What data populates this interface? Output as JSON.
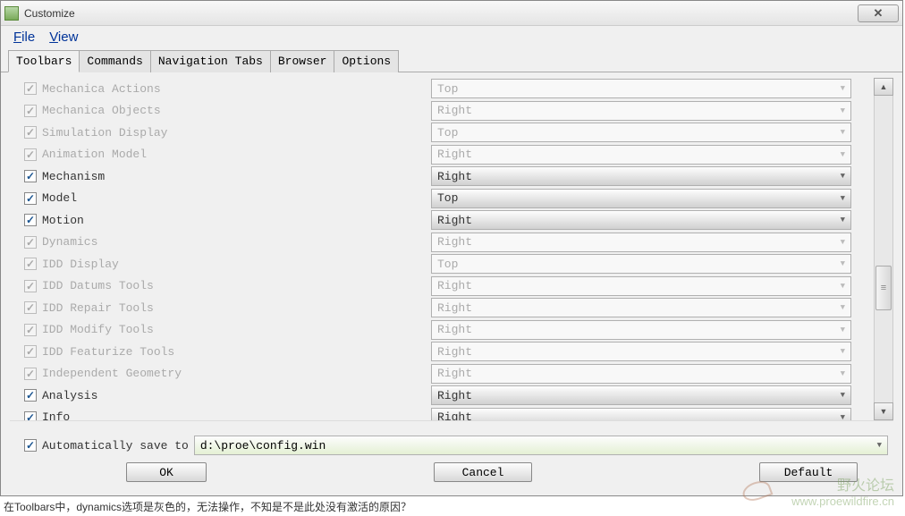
{
  "window": {
    "title": "Customize"
  },
  "menubar": {
    "file": "File",
    "view": "View"
  },
  "tabs": [
    {
      "label": "Toolbars",
      "active": true
    },
    {
      "label": "Commands",
      "active": false
    },
    {
      "label": "Navigation Tabs",
      "active": false
    },
    {
      "label": "Browser",
      "active": false
    },
    {
      "label": "Options",
      "active": false
    }
  ],
  "toolbars": [
    {
      "name": "Mechanica Actions",
      "position": "Top",
      "enabled": false,
      "checked": true
    },
    {
      "name": "Mechanica Objects",
      "position": "Right",
      "enabled": false,
      "checked": true
    },
    {
      "name": "Simulation Display",
      "position": "Top",
      "enabled": false,
      "checked": true
    },
    {
      "name": "Animation Model",
      "position": "Right",
      "enabled": false,
      "checked": true
    },
    {
      "name": "Mechanism",
      "position": "Right",
      "enabled": true,
      "checked": true
    },
    {
      "name": "Model",
      "position": "Top",
      "enabled": true,
      "checked": true
    },
    {
      "name": "Motion",
      "position": "Right",
      "enabled": true,
      "checked": true
    },
    {
      "name": "Dynamics",
      "position": "Right",
      "enabled": false,
      "checked": true
    },
    {
      "name": "IDD Display",
      "position": "Top",
      "enabled": false,
      "checked": true
    },
    {
      "name": "IDD Datums Tools",
      "position": "Right",
      "enabled": false,
      "checked": true
    },
    {
      "name": "IDD Repair Tools",
      "position": "Right",
      "enabled": false,
      "checked": true
    },
    {
      "name": "IDD Modify Tools",
      "position": "Right",
      "enabled": false,
      "checked": true
    },
    {
      "name": "IDD Featurize Tools",
      "position": "Right",
      "enabled": false,
      "checked": true
    },
    {
      "name": "Independent Geometry",
      "position": "Right",
      "enabled": false,
      "checked": true
    },
    {
      "name": "Analysis",
      "position": "Right",
      "enabled": true,
      "checked": true
    },
    {
      "name": "Info",
      "position": "Right",
      "enabled": true,
      "checked": true
    }
  ],
  "autosave": {
    "label": "Automatically save to",
    "value": "d:\\proe\\config.win",
    "checked": true
  },
  "buttons": {
    "ok": "OK",
    "cancel": "Cancel",
    "default": "Default"
  },
  "footnote": "在Toolbars中，dynamics选项是灰色的，无法操作，不知是不是此处没有激活的原因？",
  "watermark": {
    "text": "野火论坛",
    "url": "www.proewildfire.cn"
  }
}
